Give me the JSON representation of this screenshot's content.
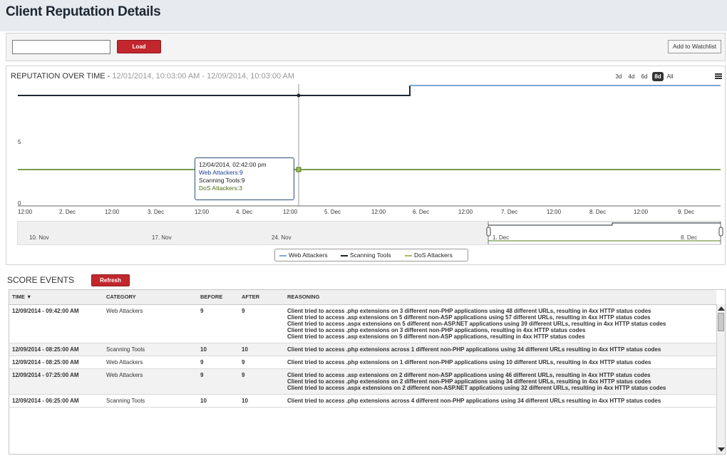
{
  "page": {
    "title": "Client Reputation Details"
  },
  "toolbar": {
    "ip_input_value": "",
    "load_label": "Load",
    "secondary_button_label": "Add to Watchlist"
  },
  "chart": {
    "title": "REPUTATION OVER TIME - ",
    "date_range": "12/01/2014, 10:03:00 AM - 12/09/2014, 10:03:00 AM",
    "zoom_options": [
      "3d",
      "4d",
      "6d",
      "8d",
      "All"
    ],
    "zoom_selected": "8d",
    "menu_icon": "hamburger-menu-icon",
    "y_tick_labels": [
      "5",
      "0"
    ],
    "x_tick_labels": [
      "12:00",
      "2. Dec",
      "12:00",
      "3. Dec",
      "12:00",
      "4. Dec",
      "12:00",
      "5. Dec",
      "12:00",
      "6. Dec",
      "12:00",
      "7. Dec",
      "12:00",
      "8. Dec",
      "12:00",
      "9. Dec"
    ],
    "navigator_labels": [
      "10. Nov",
      "17. Nov",
      "24. Nov",
      "1. Dec",
      "8. Dec"
    ],
    "tooltip": {
      "date": "12/04/2014, 02:42:00 pm",
      "web": "Web Attackers:9",
      "scan": "Scanning Tools:9",
      "dos": "DoS Attackers:3"
    },
    "legend": [
      {
        "label": "Web Attackers",
        "color": "#7aa7d6"
      },
      {
        "label": "Scanning Tools",
        "color": "#1c2733"
      },
      {
        "label": "DoS Attackers",
        "color": "#a9b85c"
      }
    ]
  },
  "chart_data": {
    "type": "line",
    "title": "REPUTATION OVER TIME",
    "ylim": [
      0,
      10
    ],
    "x_range": [
      "12/01/2014 10:03",
      "12/09/2014 10:03"
    ],
    "series": [
      {
        "name": "Web Attackers",
        "color": "#7aa7d6",
        "points": [
          [
            "12/05/2014 09:25",
            10
          ],
          [
            "12/09/2014 10:03",
            10
          ]
        ]
      },
      {
        "name": "Scanning Tools",
        "color": "#1c2733",
        "points": [
          [
            "12/01/2014 10:03",
            9
          ],
          [
            "12/05/2014 09:25",
            9
          ]
        ]
      },
      {
        "name": "DoS Attackers",
        "color": "#4b7a14",
        "points": [
          [
            "12/01/2014 10:03",
            3
          ],
          [
            "12/09/2014 10:03",
            3
          ]
        ]
      }
    ],
    "legend": "bottom",
    "grid": false
  },
  "score_events": {
    "title": "SCORE EVENTS",
    "refresh_label": "Refresh",
    "columns": [
      "TIME ▼",
      "CATEGORY",
      "BEFORE",
      "AFTER",
      "REASONING"
    ],
    "rows": [
      {
        "time": "12/09/2014 - 09:42:00 AM",
        "category": "Web Attackers",
        "before": "9",
        "after": "9",
        "reasoning": [
          "Client tried to access .php extensions on 3 different non-PHP applications using 48 different URLs, resulting in 4xx HTTP status codes",
          "Client tried to access .asp extensions on 5 different non-ASP applications using 57 different URLs, resulting in 4xx HTTP status codes",
          "Client tried to access .aspx extensions on 5 different non-ASP.NET applications using 39 different URLs, resulting in 4xx HTTP status codes",
          "Client tried to access .php extensions on 3 different non-PHP applications, resulting in 4xx HTTP status codes",
          "Client tried to access .asp extensions on 5 different non-ASP applications, resulting in 4xx HTTP status codes"
        ]
      },
      {
        "time": "12/09/2014 - 08:25:00 AM",
        "category": "Scanning Tools",
        "before": "10",
        "after": "10",
        "reasoning": [
          "Client tried to access .php extensions across 1 different non-PHP applications using 34 different URLs resulting in 4xx HTTP status codes"
        ]
      },
      {
        "time": "12/09/2014 - 08:25:00 AM",
        "category": "Web Attackers",
        "before": "9",
        "after": "9",
        "reasoning": [
          "Client tried to access .php extensions on 1 different non-PHP applications using 10 different URLs, resulting in 4xx HTTP status codes"
        ]
      },
      {
        "time": "12/09/2014 - 07:25:00 AM",
        "category": "Web Attackers",
        "before": "9",
        "after": "9",
        "reasoning": [
          "Client tried to access .asp extensions on 2 different non-ASP applications using 46 different URLs, resulting in 4xx HTTP status codes",
          "Client tried to access .php extensions on 2 different non-PHP applications using 34 different URLs, resulting in 4xx HTTP status codes",
          "Client tried to access .aspx extensions on 2 different non-ASP.NET applications using 32 different URLs, resulting in 4xx HTTP status codes"
        ]
      },
      {
        "time": "12/09/2014 - 06:25:00 AM",
        "category": "Scanning Tools",
        "before": "10",
        "after": "10",
        "reasoning": [
          "Client tried to access .php extensions across 4 different non-PHP applications using 34 different URLs resulting in 4xx HTTP status codes"
        ]
      }
    ]
  }
}
